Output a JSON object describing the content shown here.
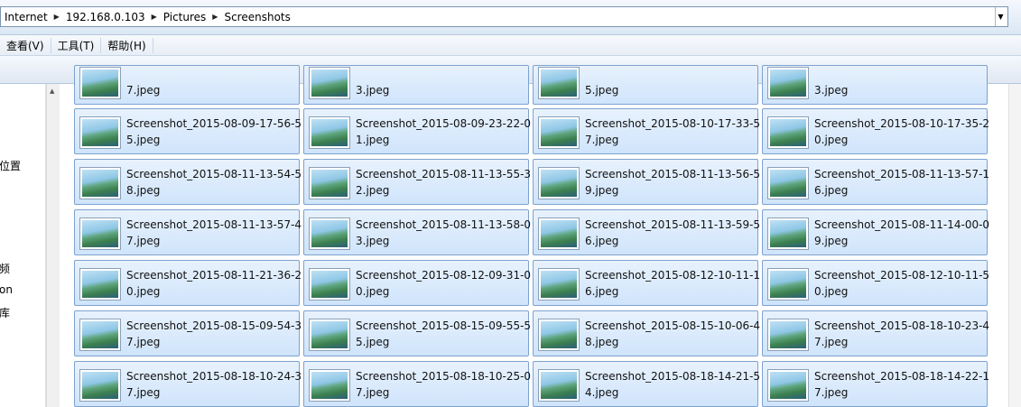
{
  "address": {
    "crumbs": [
      "Internet",
      "192.168.0.103",
      "Pictures",
      "Screenshots"
    ]
  },
  "menu": [
    "查看(V)",
    "工具(T)",
    "帮助(H)"
  ],
  "nav": {
    "items": [
      {
        "label": "位置"
      },
      {
        "label": "频"
      },
      {
        "label": "on"
      },
      {
        "label": "库"
      }
    ]
  },
  "files": [
    {
      "line1": "",
      "line2": "7.jpeg"
    },
    {
      "line1": "",
      "line2": "3.jpeg"
    },
    {
      "line1": "",
      "line2": "5.jpeg"
    },
    {
      "line1": "",
      "line2": "3.jpeg"
    },
    {
      "line1": "Screenshot_2015-08-09-17-56-5",
      "line2": "5.jpeg"
    },
    {
      "line1": "Screenshot_2015-08-09-23-22-0",
      "line2": "1.jpeg"
    },
    {
      "line1": "Screenshot_2015-08-10-17-33-5",
      "line2": "7.jpeg"
    },
    {
      "line1": "Screenshot_2015-08-10-17-35-2",
      "line2": "0.jpeg"
    },
    {
      "line1": "Screenshot_2015-08-11-13-54-5",
      "line2": "8.jpeg"
    },
    {
      "line1": "Screenshot_2015-08-11-13-55-3",
      "line2": "2.jpeg"
    },
    {
      "line1": "Screenshot_2015-08-11-13-56-5",
      "line2": "9.jpeg"
    },
    {
      "line1": "Screenshot_2015-08-11-13-57-1",
      "line2": "6.jpeg"
    },
    {
      "line1": "Screenshot_2015-08-11-13-57-4",
      "line2": "7.jpeg"
    },
    {
      "line1": "Screenshot_2015-08-11-13-58-0",
      "line2": "3.jpeg"
    },
    {
      "line1": "Screenshot_2015-08-11-13-59-5",
      "line2": "6.jpeg"
    },
    {
      "line1": "Screenshot_2015-08-11-14-00-0",
      "line2": "9.jpeg"
    },
    {
      "line1": "Screenshot_2015-08-11-21-36-2",
      "line2": "0.jpeg"
    },
    {
      "line1": "Screenshot_2015-08-12-09-31-0",
      "line2": "0.jpeg"
    },
    {
      "line1": "Screenshot_2015-08-12-10-11-1",
      "line2": "6.jpeg"
    },
    {
      "line1": "Screenshot_2015-08-12-10-11-5",
      "line2": "0.jpeg"
    },
    {
      "line1": "Screenshot_2015-08-15-09-54-3",
      "line2": "7.jpeg"
    },
    {
      "line1": "Screenshot_2015-08-15-09-55-5",
      "line2": "5.jpeg"
    },
    {
      "line1": "Screenshot_2015-08-15-10-06-4",
      "line2": "8.jpeg"
    },
    {
      "line1": "Screenshot_2015-08-18-10-23-4",
      "line2": "7.jpeg"
    },
    {
      "line1": "Screenshot_2015-08-18-10-24-3",
      "line2": "7.jpeg"
    },
    {
      "line1": "Screenshot_2015-08-18-10-25-0",
      "line2": "7.jpeg"
    },
    {
      "line1": "Screenshot_2015-08-18-14-21-5",
      "line2": "4.jpeg"
    },
    {
      "line1": "Screenshot_2015-08-18-14-22-1",
      "line2": "7.jpeg"
    }
  ]
}
